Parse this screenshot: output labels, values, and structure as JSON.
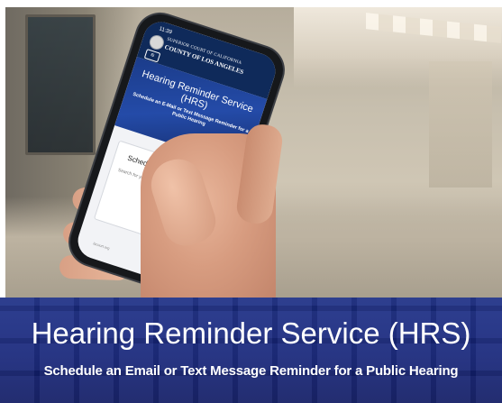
{
  "phone_screen": {
    "status_time": "11:39",
    "court_name_top": "SUPERIOR COURT OF CALIFORNIA",
    "court_name_bottom": "COUNTY OF LOS ANGELES",
    "menu_icon": "hamburger-menu-icon",
    "hero_title": "Hearing Reminder Service (HRS)",
    "hero_subtitle": "Schedule an E-Mail or Text Message Reminder for a Public Hearing",
    "card_title": "Schedu",
    "card_text": "Search for your case or for all scheduled hearin",
    "go_button_label": "Go",
    "footer_note": "lacourt.org"
  },
  "caption": {
    "title": "Hearing Reminder Service (HRS)",
    "subtitle": "Schedule an Email or Text Message Reminder for a Public Hearing",
    "band_color": "#16257a"
  }
}
